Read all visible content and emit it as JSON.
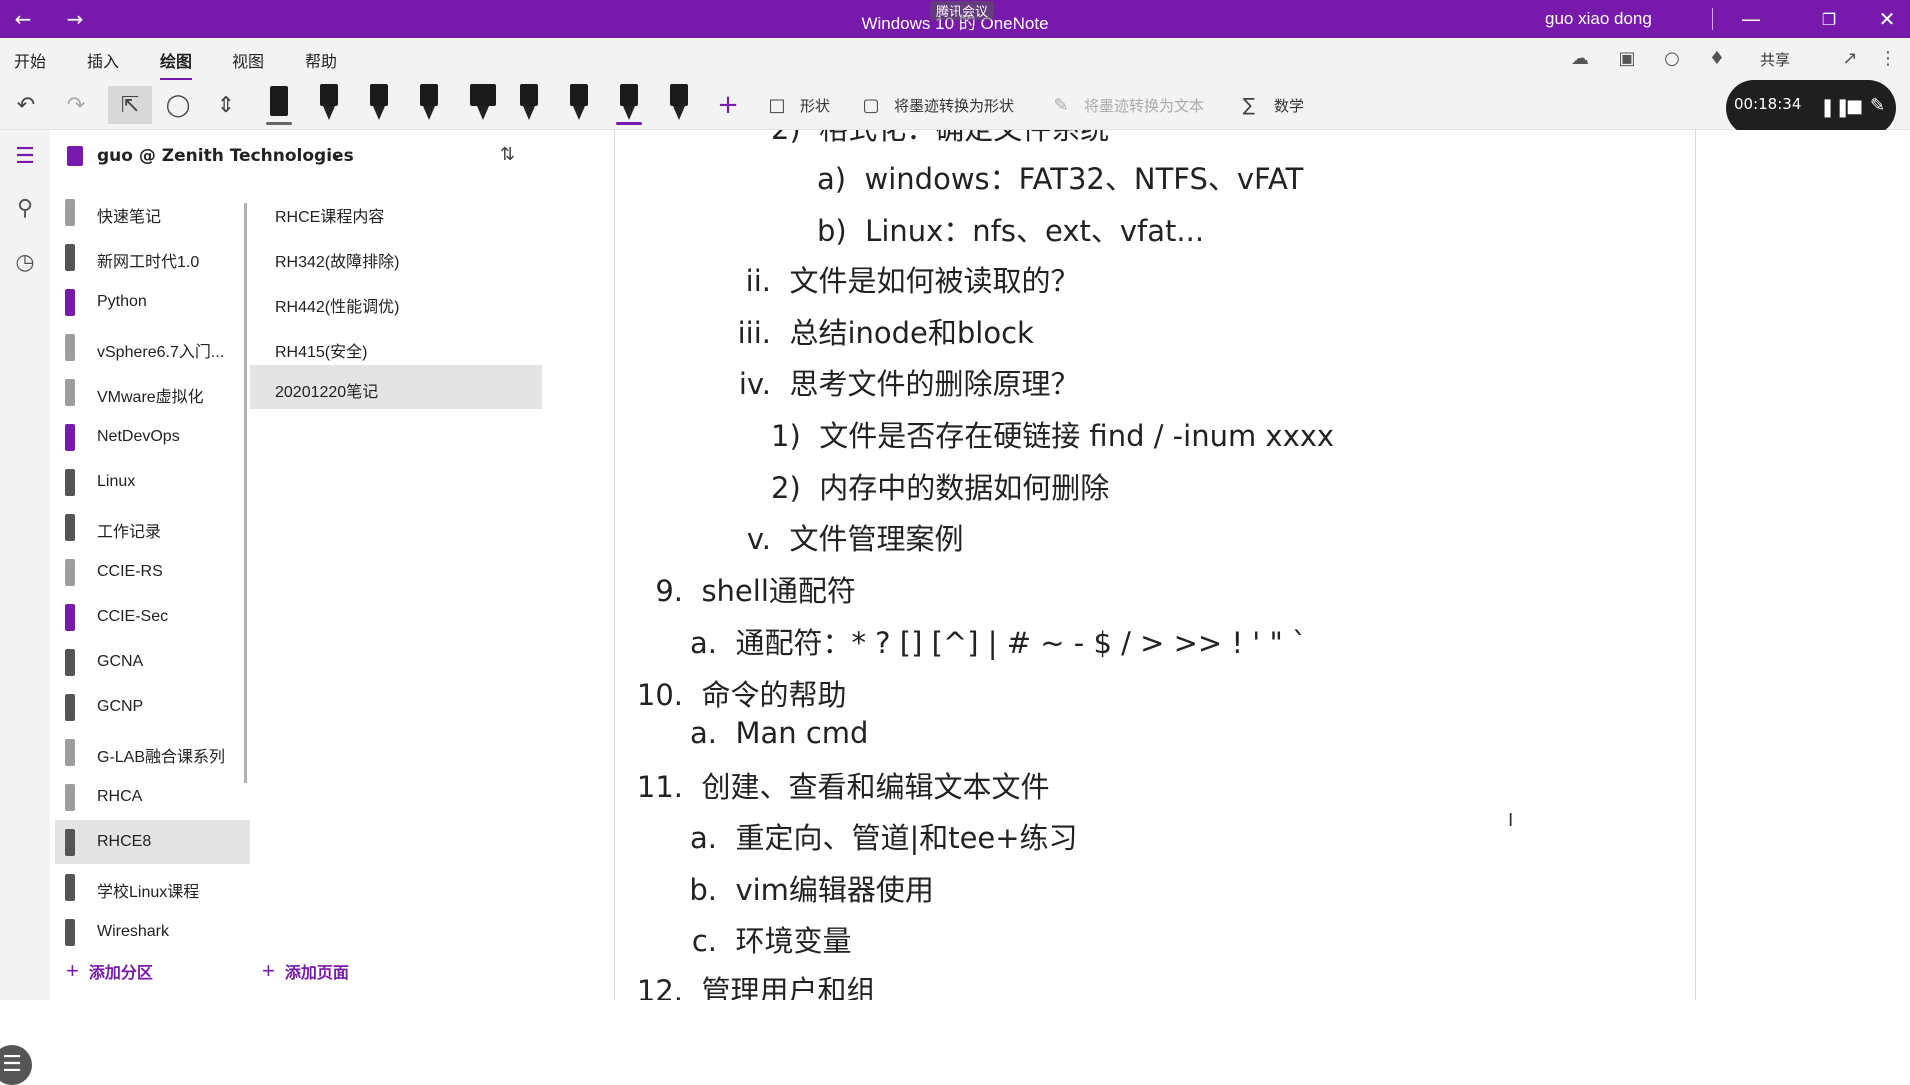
{
  "window": {
    "title": "Windows 10 的 OneNote",
    "overlay_label": "腾讯会议",
    "user": "guo xiao dong",
    "back_icon": "back-arrow-icon",
    "forward_icon": "forward-arrow-icon"
  },
  "menu": {
    "tabs": [
      "开始",
      "插入",
      "绘图",
      "视图",
      "帮助"
    ],
    "active_tab": "绘图",
    "share_label": "共享"
  },
  "toolbar": {
    "shapes_label": "形状",
    "ink_to_shape_label": "将墨迹转换为形状",
    "ink_to_text_label": "将墨迹转换为文本",
    "math_label": "数学",
    "pen_colors": [
      "#1a1a1a",
      "#1a1a1a",
      "#1a1a1a",
      "#1a1a1a",
      "#1a1a1a",
      "#1a1a1a",
      "#1a1a1a",
      "#7719aa",
      "#1a1a1a"
    ]
  },
  "recording": {
    "time": "00:18:34"
  },
  "notebook": {
    "title": "guo @ Zenith Technologies",
    "sections": [
      {
        "label": "快速笔记",
        "color": "#9e9e9e"
      },
      {
        "label": "新网工时代1.0",
        "color": "#555555"
      },
      {
        "label": "Python",
        "color": "#7719aa"
      },
      {
        "label": "vSphere6.7入门...",
        "color": "#9e9e9e"
      },
      {
        "label": "VMware虚拟化",
        "color": "#9e9e9e"
      },
      {
        "label": "NetDevOps",
        "color": "#7719aa"
      },
      {
        "label": "Linux",
        "color": "#555555"
      },
      {
        "label": "工作记录",
        "color": "#555555"
      },
      {
        "label": "CCIE-RS",
        "color": "#9e9e9e"
      },
      {
        "label": "CCIE-Sec",
        "color": "#7719aa"
      },
      {
        "label": "GCNA",
        "color": "#555555"
      },
      {
        "label": "GCNP",
        "color": "#555555"
      },
      {
        "label": "G-LAB融合课系列",
        "color": "#9e9e9e"
      },
      {
        "label": "RHCA",
        "color": "#9e9e9e"
      },
      {
        "label": "RHCE8",
        "color": "#555555"
      },
      {
        "label": "学校Linux课程",
        "color": "#555555"
      },
      {
        "label": "Wireshark",
        "color": "#555555"
      }
    ],
    "selected_section": "RHCE8",
    "pages": [
      "RHCE课程内容",
      "RH342(故障排除)",
      "RH442(性能调优)",
      "RH415(安全)",
      "20201220笔记"
    ],
    "selected_page": "20201220笔记",
    "add_section": "添加分区",
    "add_page": "添加页面"
  },
  "note_lines": [
    {
      "marker": "2)",
      "text": "格式化：确定文件系统"
    },
    {
      "marker": "a)",
      "text": "windows：FAT32、NTFS、vFAT"
    },
    {
      "marker": "b)",
      "text": "Linux：nfs、ext、vfat..."
    },
    {
      "marker": "ii.",
      "text": "文件是如何被读取的？"
    },
    {
      "marker": "iii.",
      "text": "总结inode和block"
    },
    {
      "marker": "iv.",
      "text": "思考文件的删除原理？"
    },
    {
      "marker": "1)",
      "text": "文件是否存在硬链接 find / -inum xxxx"
    },
    {
      "marker": "2)",
      "text": "内存中的数据如何删除"
    },
    {
      "marker": "v.",
      "text": "文件管理案例"
    },
    {
      "marker": "9.",
      "text": "shell通配符"
    },
    {
      "marker": "a.",
      "text": "通配符：* ? [] [^] | # ~ - $ / > >> ! ' \" `"
    },
    {
      "marker": "10.",
      "text": "命令的帮助"
    },
    {
      "marker": "a.",
      "text": "Man cmd"
    },
    {
      "marker": "11.",
      "text": "创建、查看和编辑文本文件"
    },
    {
      "marker": "a.",
      "text": "重定向、管道|和tee+练习"
    },
    {
      "marker": "b.",
      "text": "vim编辑器使用"
    },
    {
      "marker": "c.",
      "text": "环境变量"
    },
    {
      "marker": "12.",
      "text": "管理用户和组"
    }
  ]
}
